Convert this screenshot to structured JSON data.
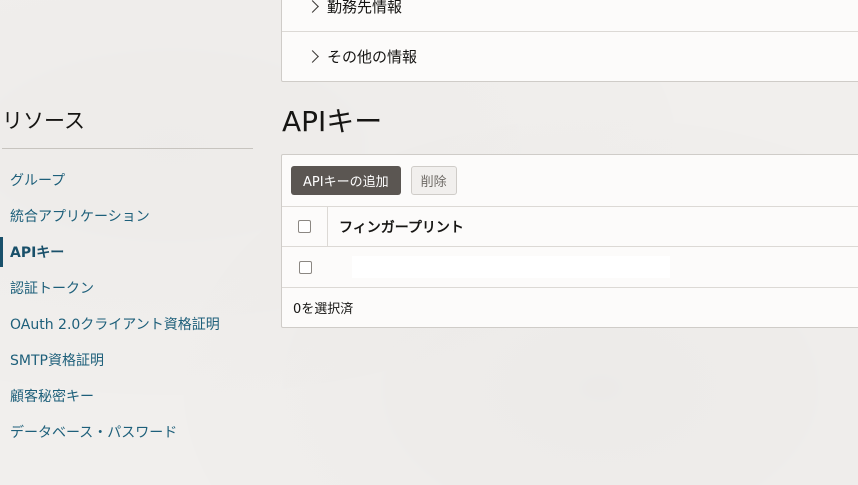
{
  "accordion": {
    "items": [
      {
        "label": "勤務先情報"
      },
      {
        "label": "その他の情報"
      }
    ]
  },
  "resources": {
    "title": "リソース",
    "items": [
      {
        "label": "グループ"
      },
      {
        "label": "統合アプリケーション"
      },
      {
        "label": "APIキー",
        "active": true
      },
      {
        "label": "認証トークン"
      },
      {
        "label": "OAuth 2.0クライアント資格証明"
      },
      {
        "label": "SMTP資格証明"
      },
      {
        "label": "顧客秘密キー"
      },
      {
        "label": "データベース・パスワード"
      }
    ]
  },
  "main": {
    "title": "APIキー",
    "toolbar": {
      "add_label": "APIキーの追加",
      "delete_label": "削除"
    },
    "table": {
      "columns": [
        "フィンガープリント"
      ],
      "rows": [
        {
          "fingerprint": ""
        }
      ]
    },
    "footer": {
      "selected_text": "0を選択済"
    }
  },
  "colors": {
    "link": "#1d5f7a",
    "primary_button": "#5b5652",
    "background": "#f1efed"
  },
  "icons": {
    "chevron": "chevron-right-icon"
  }
}
